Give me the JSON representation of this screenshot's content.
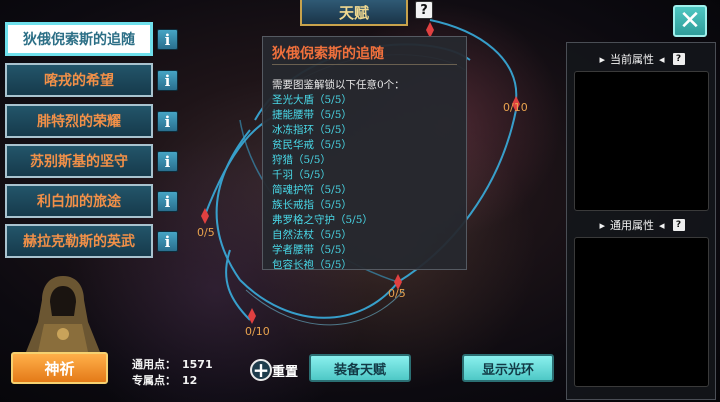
{
  "header": {
    "title": "天赋",
    "help_icon": "question-icon",
    "close_icon": "close-icon"
  },
  "sets": [
    {
      "label": "狄俄倪索斯的追随",
      "active": true
    },
    {
      "label": "喀戎的希望",
      "active": false
    },
    {
      "label": "腓特烈的荣耀",
      "active": false
    },
    {
      "label": "苏别斯基的坚守",
      "active": false
    },
    {
      "label": "利白加的旅途",
      "active": false
    },
    {
      "label": "赫拉克勒斯的英武",
      "active": false
    }
  ],
  "info_icon_label": "i",
  "tooltip": {
    "title": "狄俄倪索斯的追随",
    "requirement": "需要图鉴解锁以下任意0个：",
    "items": [
      "圣光大盾（5/5）",
      "捷能腰带（5/5）",
      "冰冻指环（5/5）",
      "贫民华戒（5/5）",
      "狩猎（5/5）",
      "千羽（5/5）",
      "简魂护符（5/5）",
      "族长戒指（5/5）",
      "弗罗格之守护（5/5）",
      "自然法杖（5/5）",
      "学者腰带（5/5）",
      "包容长袍（5/5）"
    ]
  },
  "constellation_labels": [
    "0/10",
    "0/5",
    "0/5",
    "0/10"
  ],
  "right_panel": {
    "current_label": "当前属性",
    "general_label": "通用属性"
  },
  "bottom": {
    "pray_label": "神祈",
    "general_points_label": "通用点：",
    "general_points_value": "1571",
    "special_points_label": "专属点：",
    "special_points_value": "12",
    "reset_label": "重置",
    "equip_label": "装备天赋",
    "halo_label": "显示光环"
  },
  "colors": {
    "accent_teal": "#4ec8c6",
    "accent_orange": "#f29048",
    "constellation": "#3ab6e8"
  }
}
